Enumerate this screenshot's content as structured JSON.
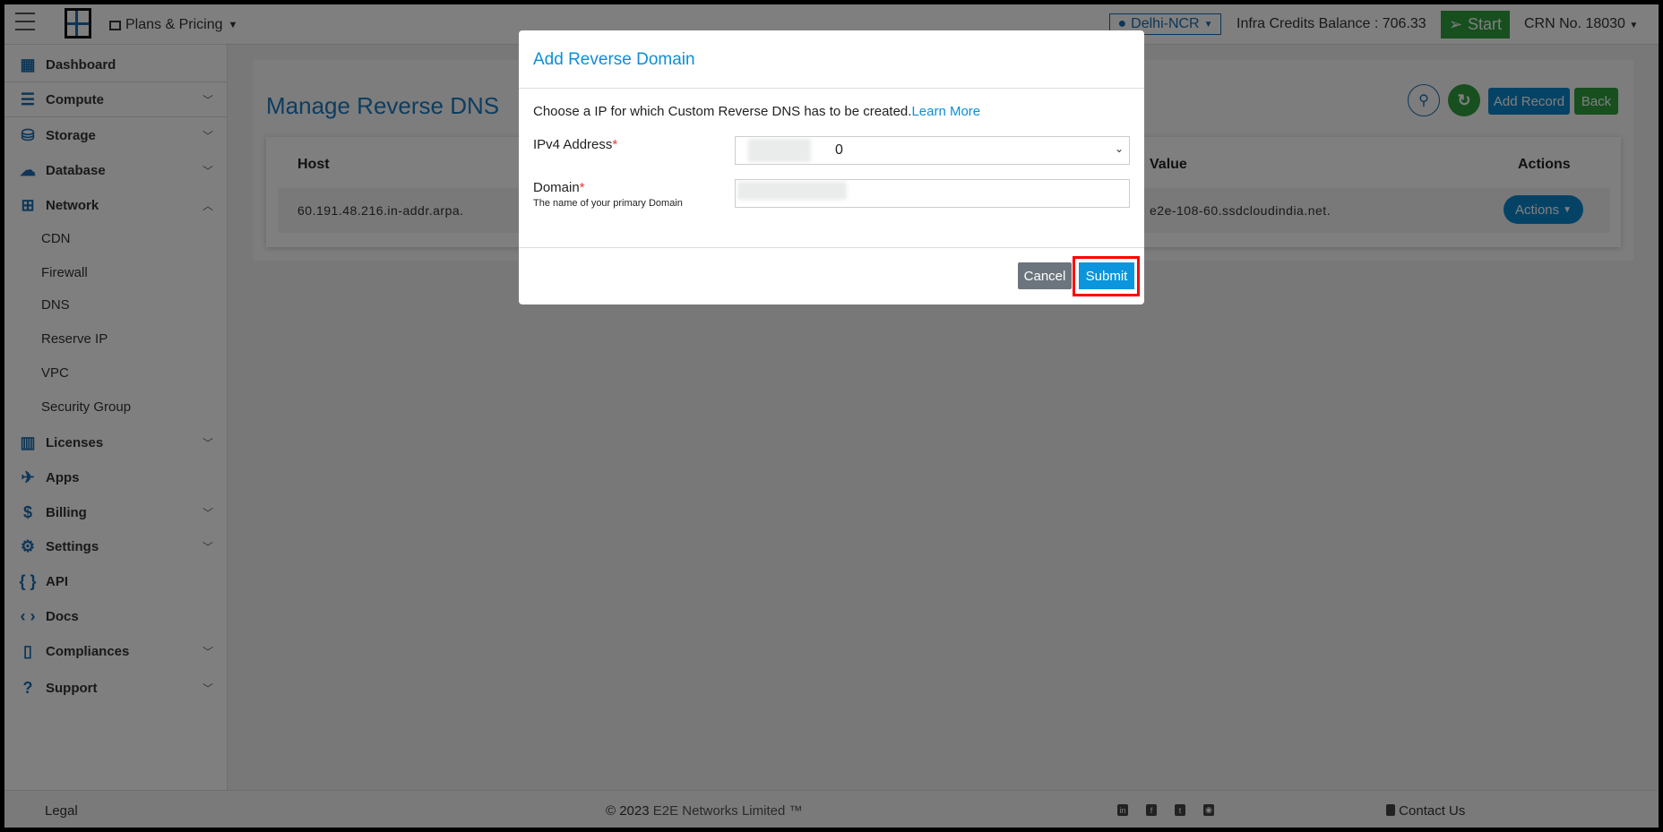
{
  "topbar": {
    "plans_label": "Plans & Pricing",
    "logo_text": "E2E Networks",
    "region": "Delhi-NCR",
    "credits": "Infra Credits Balance : 706.33",
    "start_label": "Start",
    "crn": "CRN No. 18030"
  },
  "sidebar": {
    "items": [
      {
        "label": "Dashboard",
        "icon": "dashboard-icon"
      },
      {
        "label": "Compute",
        "icon": "server-icon",
        "chevron": "down"
      },
      {
        "label": "Storage",
        "icon": "database-icon",
        "chevron": "down"
      },
      {
        "label": "Database",
        "icon": "cloud-database-icon",
        "chevron": "down"
      },
      {
        "label": "Network",
        "icon": "network-icon",
        "chevron": "up"
      },
      {
        "label": "Licenses",
        "icon": "license-icon",
        "chevron": "down"
      },
      {
        "label": "Apps",
        "icon": "rocket-icon"
      },
      {
        "label": "Billing",
        "icon": "billing-icon",
        "chevron": "down"
      },
      {
        "label": "Settings",
        "icon": "gear-icon",
        "chevron": "down"
      },
      {
        "label": "API",
        "icon": "braces-icon"
      },
      {
        "label": "Docs",
        "icon": "code-icon"
      },
      {
        "label": "Compliances",
        "icon": "document-icon",
        "chevron": "down"
      },
      {
        "label": "Support",
        "icon": "support-icon",
        "chevron": "down"
      }
    ],
    "network_sub": [
      "CDN",
      "Firewall",
      "DNS",
      "Reserve IP",
      "VPC",
      "Security Group"
    ]
  },
  "main": {
    "title": "Manage Reverse DNS",
    "add_record": "Add Record",
    "back": "Back",
    "table": {
      "headers": [
        "Host",
        "Value",
        "Actions"
      ],
      "rows": [
        {
          "host": "60.191.48.216.in-addr.arpa.",
          "value": "e2e-108-60.ssdcloudindia.net.",
          "action": "Actions"
        }
      ]
    }
  },
  "modal": {
    "title": "Add Reverse Domain",
    "intro": "Choose a IP for which Custom Reverse DNS has to be created.",
    "learn_more": "Learn More",
    "ipv4_label": "IPv4 Address",
    "ipv4_value": "0",
    "domain_label": "Domain",
    "domain_help": "The name of your primary Domain",
    "required_mark": "*",
    "cancel": "Cancel",
    "submit": "Submit"
  },
  "footer": {
    "legal": "Legal",
    "copyright_prefix": "© 2023 ",
    "company": "E2E Networks Limited ™",
    "contact": "Contact Us",
    "social": [
      "linkedin-icon",
      "facebook-icon",
      "twitter-icon",
      "rss-icon"
    ]
  },
  "colors": {
    "accent": "#1a8fd6",
    "green": "#28a745",
    "highlight": "#ff0000"
  }
}
